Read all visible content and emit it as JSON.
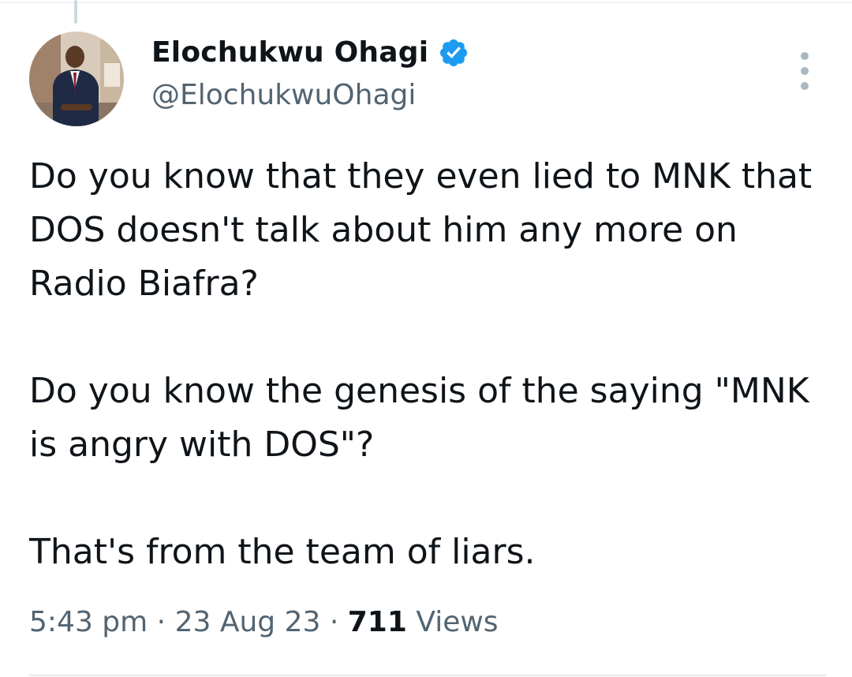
{
  "tweet": {
    "author": {
      "display_name": "Elochukwu Ohagi",
      "handle": "@ElochukwuOhagi",
      "verified": true,
      "verified_color": "#1d9bf0"
    },
    "paragraphs": [
      "Do you know that they even lied to MNK that DOS doesn't talk about him any more on Radio Biafra?",
      "Do you know the genesis of the saying \"MNK is angry with DOS\"?",
      "That's from the team of liars."
    ],
    "meta": {
      "time": "5:43 pm",
      "separator": "·",
      "date": "23 Aug 23",
      "views_count": "711",
      "views_label": "Views"
    }
  }
}
